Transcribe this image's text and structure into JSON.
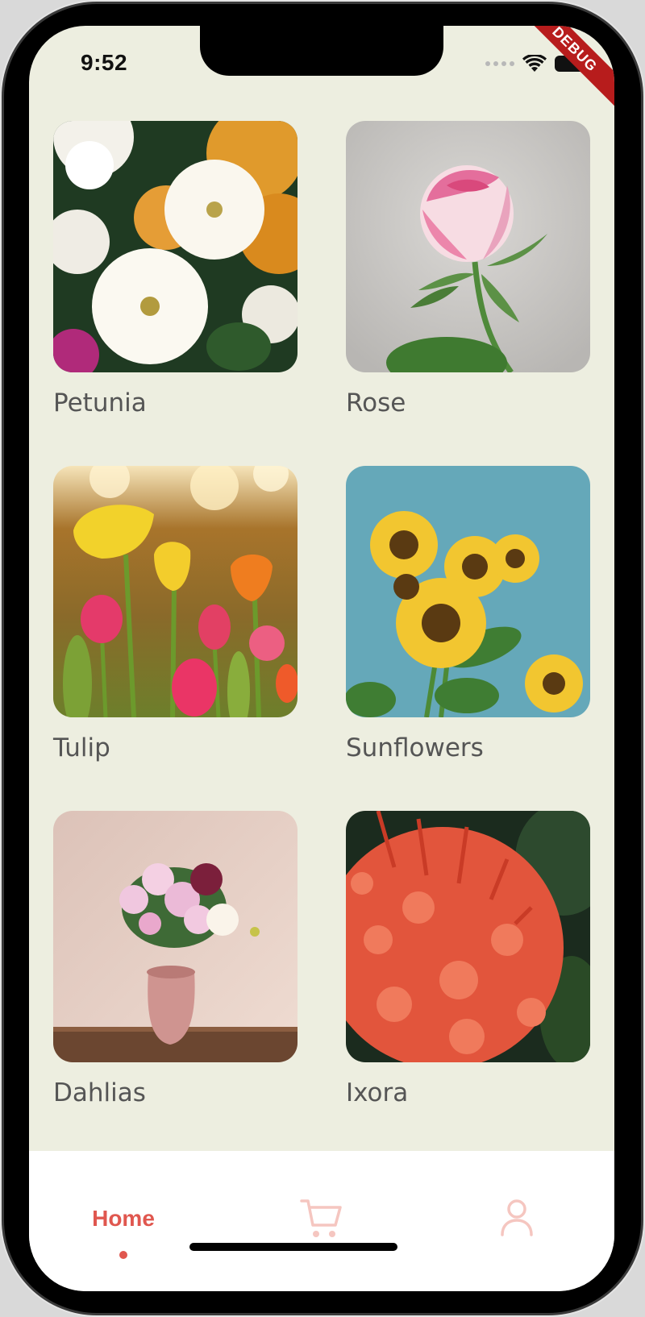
{
  "status_bar": {
    "time": "9:52",
    "debug_label": "DEBUG"
  },
  "flowers": [
    {
      "name": "Petunia"
    },
    {
      "name": "Rose"
    },
    {
      "name": "Tulip"
    },
    {
      "name": "Sunflowers"
    },
    {
      "name": "Dahlias"
    },
    {
      "name": "Ixora"
    }
  ],
  "bottom_nav": {
    "home_label": "Home",
    "cart_icon": "cart-icon",
    "profile_icon": "user-icon",
    "active_color": "#e0574f",
    "inactive_color": "#f5c6c0"
  },
  "colors": {
    "background": "#edeee0",
    "nav_background": "#ffffff",
    "label_text": "#555555"
  }
}
